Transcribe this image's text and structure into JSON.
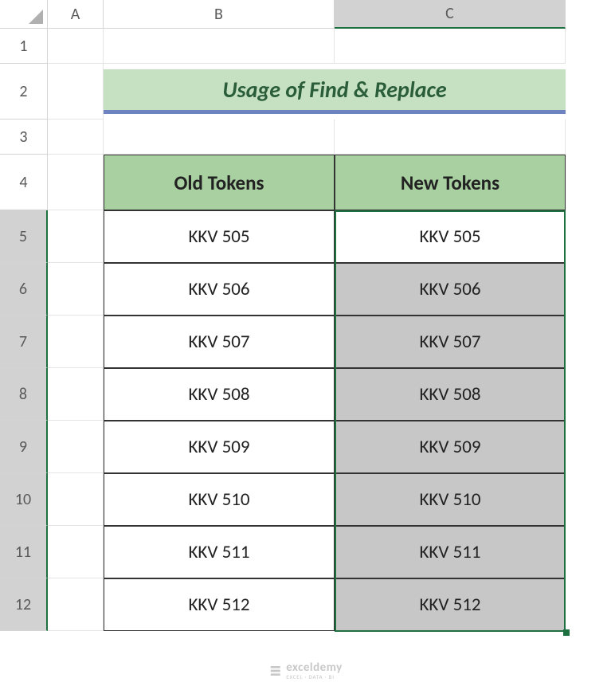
{
  "columns": [
    "A",
    "B",
    "C"
  ],
  "rows": [
    "1",
    "2",
    "3",
    "4",
    "5",
    "6",
    "7",
    "8",
    "9",
    "10",
    "11",
    "12"
  ],
  "title": "Usage of Find & Replace",
  "headers": {
    "b": "Old Tokens",
    "c": "New Tokens"
  },
  "chart_data": {
    "type": "table",
    "title": "Usage of Find & Replace",
    "columns": [
      "Old Tokens",
      "New Tokens"
    ],
    "rows": [
      [
        "KKV 505",
        "KKV 505"
      ],
      [
        "KKV 506",
        "KKV 506"
      ],
      [
        "KKV 507",
        "KKV 507"
      ],
      [
        "KKV 508",
        "KKV 508"
      ],
      [
        "KKV 509",
        "KKV 509"
      ],
      [
        "KKV 510",
        "KKV 510"
      ],
      [
        "KKV 511",
        "KKV 511"
      ],
      [
        "KKV 512",
        "KKV 512"
      ]
    ]
  },
  "watermark": {
    "name": "exceldemy",
    "tag": "EXCEL · DATA · BI"
  }
}
